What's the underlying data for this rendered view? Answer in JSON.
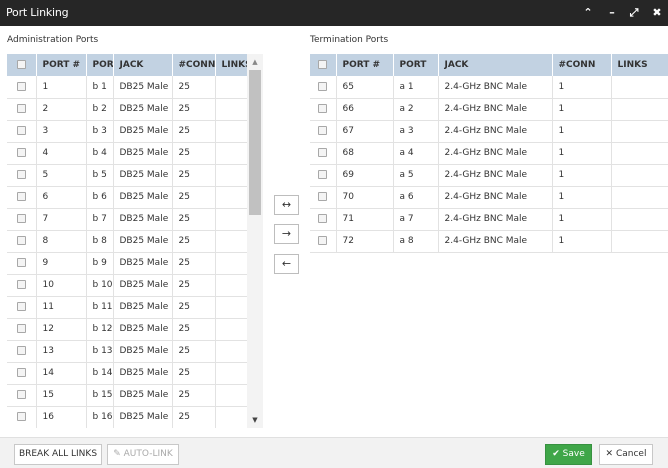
{
  "window": {
    "title": "Port Linking",
    "controls": {
      "collapse": "⌃",
      "minimize": "–",
      "maximize": "⤢",
      "close": "✖"
    }
  },
  "admin": {
    "label": "Administration Ports",
    "columns": [
      "PORT #",
      "PORT",
      "JACK",
      "#CONN",
      "LINKS"
    ],
    "rows": [
      [
        "1",
        "b 1",
        "DB25 Male",
        "25",
        ""
      ],
      [
        "2",
        "b 2",
        "DB25 Male",
        "25",
        ""
      ],
      [
        "3",
        "b 3",
        "DB25 Male",
        "25",
        ""
      ],
      [
        "4",
        "b 4",
        "DB25 Male",
        "25",
        ""
      ],
      [
        "5",
        "b 5",
        "DB25 Male",
        "25",
        ""
      ],
      [
        "6",
        "b 6",
        "DB25 Male",
        "25",
        ""
      ],
      [
        "7",
        "b 7",
        "DB25 Male",
        "25",
        ""
      ],
      [
        "8",
        "b 8",
        "DB25 Male",
        "25",
        ""
      ],
      [
        "9",
        "b 9",
        "DB25 Male",
        "25",
        ""
      ],
      [
        "10",
        "b 10",
        "DB25 Male",
        "25",
        ""
      ],
      [
        "11",
        "b 11",
        "DB25 Male",
        "25",
        ""
      ],
      [
        "12",
        "b 12",
        "DB25 Male",
        "25",
        ""
      ],
      [
        "13",
        "b 13",
        "DB25 Male",
        "25",
        ""
      ],
      [
        "14",
        "b 14",
        "DB25 Male",
        "25",
        ""
      ],
      [
        "15",
        "b 15",
        "DB25 Male",
        "25",
        ""
      ],
      [
        "16",
        "b 16",
        "DB25 Male",
        "25",
        ""
      ]
    ]
  },
  "termination": {
    "label": "Termination Ports",
    "columns": [
      "PORT #",
      "PORT",
      "JACK",
      "#CONN",
      "LINKS"
    ],
    "rows": [
      [
        "65",
        "a 1",
        "2.4-GHz BNC Male",
        "1",
        ""
      ],
      [
        "66",
        "a 2",
        "2.4-GHz BNC Male",
        "1",
        ""
      ],
      [
        "67",
        "a 3",
        "2.4-GHz BNC Male",
        "1",
        ""
      ],
      [
        "68",
        "a 4",
        "2.4-GHz BNC Male",
        "1",
        ""
      ],
      [
        "69",
        "a 5",
        "2.4-GHz BNC Male",
        "1",
        ""
      ],
      [
        "70",
        "a 6",
        "2.4-GHz BNC Male",
        "1",
        ""
      ],
      [
        "71",
        "a 7",
        "2.4-GHz BNC Male",
        "1",
        ""
      ],
      [
        "72",
        "a 8",
        "2.4-GHz BNC Male",
        "1",
        ""
      ]
    ]
  },
  "middle_actions": {
    "link_both": "↔",
    "link_right": "→",
    "unlink_left": "←"
  },
  "footer": {
    "break_all": "BREAK ALL LINKS",
    "auto_link": "✎ AUTO-LINK",
    "save": "✔ Save",
    "cancel": "✕ Cancel"
  },
  "colors": {
    "titlebar": "#262626",
    "header": "#c2d2e2",
    "save": "#3fa648"
  }
}
